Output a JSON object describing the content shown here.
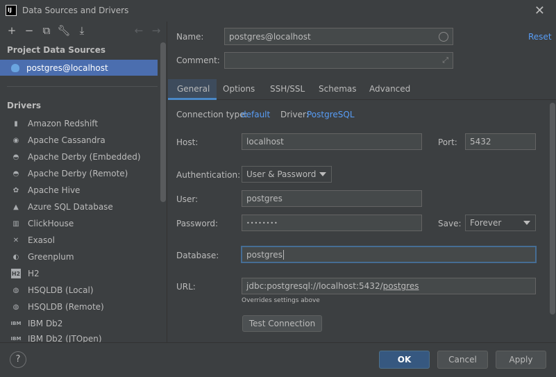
{
  "window": {
    "title": "Data Sources and Drivers",
    "app_icon": "IJ"
  },
  "sidebar": {
    "project_header": "Project Data Sources",
    "selected_source": "postgres@localhost",
    "drivers_header": "Drivers",
    "drivers": [
      {
        "label": "Amazon Redshift",
        "icon": "redshift-icon"
      },
      {
        "label": "Apache Cassandra",
        "icon": "cassandra-icon"
      },
      {
        "label": "Apache Derby (Embedded)",
        "icon": "derby-icon"
      },
      {
        "label": "Apache Derby (Remote)",
        "icon": "derby-icon"
      },
      {
        "label": "Apache Hive",
        "icon": "hive-icon"
      },
      {
        "label": "Azure SQL Database",
        "icon": "azure-icon"
      },
      {
        "label": "ClickHouse",
        "icon": "clickhouse-icon"
      },
      {
        "label": "Exasol",
        "icon": "exasol-icon"
      },
      {
        "label": "Greenplum",
        "icon": "greenplum-icon"
      },
      {
        "label": "H2",
        "icon": "h2-icon"
      },
      {
        "label": "HSQLDB (Local)",
        "icon": "hsqldb-icon"
      },
      {
        "label": "HSQLDB (Remote)",
        "icon": "hsqldb-icon"
      },
      {
        "label": "IBM Db2",
        "icon": "db2-icon"
      },
      {
        "label": "IBM Db2 (JTOpen)",
        "icon": "db2-icon"
      }
    ]
  },
  "form": {
    "name_label": "Name:",
    "name_value": "postgres@localhost",
    "comment_label": "Comment:",
    "comment_value": "",
    "reset": "Reset",
    "tabs": [
      "General",
      "Options",
      "SSH/SSL",
      "Schemas",
      "Advanced"
    ],
    "connection_type_label": "Connection type:",
    "connection_type_value": "default",
    "driver_label": "Driver:",
    "driver_value": "PostgreSQL",
    "host_label": "Host:",
    "host_value": "localhost",
    "port_label": "Port:",
    "port_value": "5432",
    "auth_label": "Authentication:",
    "auth_value": "User & Password",
    "user_label": "User:",
    "user_value": "postgres",
    "password_label": "Password:",
    "password_value": "••••••••",
    "save_label": "Save:",
    "save_value": "Forever",
    "database_label": "Database:",
    "database_value": "postgres",
    "url_label": "URL:",
    "url_prefix": "jdbc:postgresql://localhost:5432/",
    "url_db": "postgres",
    "url_hint": "Overrides settings above",
    "test_connection": "Test Connection"
  },
  "footer": {
    "help": "?",
    "ok": "OK",
    "cancel": "Cancel",
    "apply": "Apply"
  }
}
